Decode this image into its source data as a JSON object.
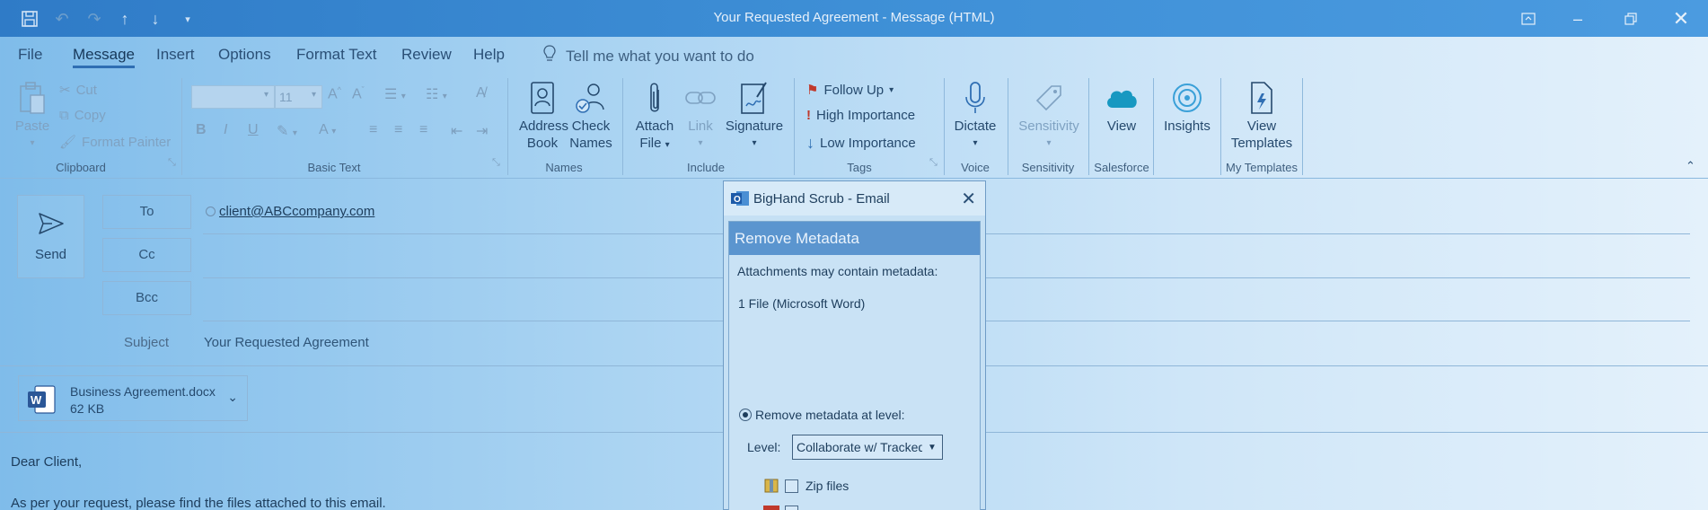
{
  "window": {
    "title": "Your Requested Agreement  -  Message (HTML)"
  },
  "menu": {
    "tabs": [
      "File",
      "Message",
      "Insert",
      "Options",
      "Format Text",
      "Review",
      "Help"
    ],
    "active": "Message",
    "tell_me": "Tell me what you want to do"
  },
  "ribbon": {
    "clipboard": {
      "paste": "Paste",
      "cut": "Cut",
      "copy": "Copy",
      "format_painter": "Format Painter",
      "label": "Clipboard"
    },
    "basic_text": {
      "font_size": "11",
      "label": "Basic Text"
    },
    "names": {
      "address_book_1": "Address",
      "address_book_2": "Book",
      "check_names_1": "Check",
      "check_names_2": "Names",
      "label": "Names"
    },
    "include": {
      "attach_1": "Attach",
      "attach_2": "File",
      "link": "Link",
      "signature": "Signature",
      "label": "Include"
    },
    "tags": {
      "follow_up": "Follow Up",
      "high": "High Importance",
      "low": "Low Importance",
      "label": "Tags"
    },
    "voice": {
      "dictate": "Dictate",
      "label": "Voice"
    },
    "sensitivity": {
      "button": "Sensitivity",
      "label": "Sensitivity"
    },
    "salesforce": {
      "view": "View",
      "label": "Salesforce"
    },
    "insights": {
      "button": "Insights"
    },
    "my_templates": {
      "view_1": "View",
      "view_2": "Templates",
      "label": "My Templates"
    }
  },
  "compose": {
    "send": "Send",
    "to_label": "To",
    "cc_label": "Cc",
    "bcc_label": "Bcc",
    "to_value": "client@ABCcompany.com",
    "subject_label": "Subject",
    "subject_value": "Your Requested Agreement",
    "attachment": {
      "name": "Business Agreement.docx",
      "size": "62 KB"
    },
    "body": {
      "greeting": "Dear Client,",
      "line1": "As per your request, please find the files attached to this email."
    }
  },
  "dialog": {
    "title": "BigHand Scrub - Email",
    "header": "Remove Metadata",
    "attachments_text": "Attachments may contain metadata:",
    "file_count": "1 File (Microsoft Word)",
    "radio_label": "Remove metadata at level:",
    "level_label": "Level:",
    "level_value": "Collaborate w/ Tracked Changes",
    "zip_label": "Zip files"
  },
  "colors": {
    "titlebar": "#3e8fd6",
    "accent": "#2f6eb3",
    "dialog_header": "#5b95cf"
  }
}
